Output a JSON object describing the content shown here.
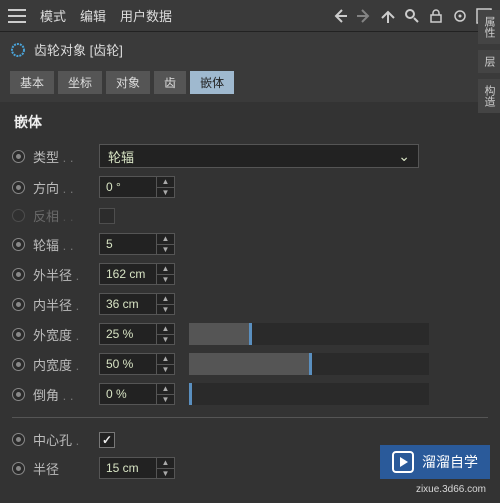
{
  "menu": {
    "mode": "模式",
    "edit": "编辑",
    "user_data": "用户数据"
  },
  "object": {
    "label": "齿轮对象 [齿轮]"
  },
  "tabs": {
    "basic": "基本",
    "coord": "坐标",
    "object": "对象",
    "teeth": "齿",
    "inlay": "嵌体"
  },
  "section": "嵌体",
  "props": {
    "type": {
      "label": "类型",
      "value": "轮辐"
    },
    "direction": {
      "label": "方向",
      "value": "0 °"
    },
    "invert": {
      "label": "反相"
    },
    "spokes": {
      "label": "轮辐",
      "value": "5"
    },
    "outer_radius": {
      "label": "外半径",
      "value": "162 cm"
    },
    "inner_radius": {
      "label": "内半径",
      "value": "36 cm"
    },
    "outer_width": {
      "label": "外宽度",
      "value": "25 %",
      "pct": 25
    },
    "inner_width": {
      "label": "内宽度",
      "value": "50 %",
      "pct": 50
    },
    "bevel": {
      "label": "倒角",
      "value": "0 %",
      "pct": 0
    },
    "center_hole": {
      "label": "中心孔",
      "checked": true
    },
    "radius_bottom": {
      "label": "半径",
      "value": "15 cm"
    }
  },
  "side_tabs": {
    "attr": "属性",
    "layer": "层",
    "struct": "构造"
  },
  "watermark": {
    "text": "溜溜自学",
    "url": "zixue.3d66.com"
  }
}
